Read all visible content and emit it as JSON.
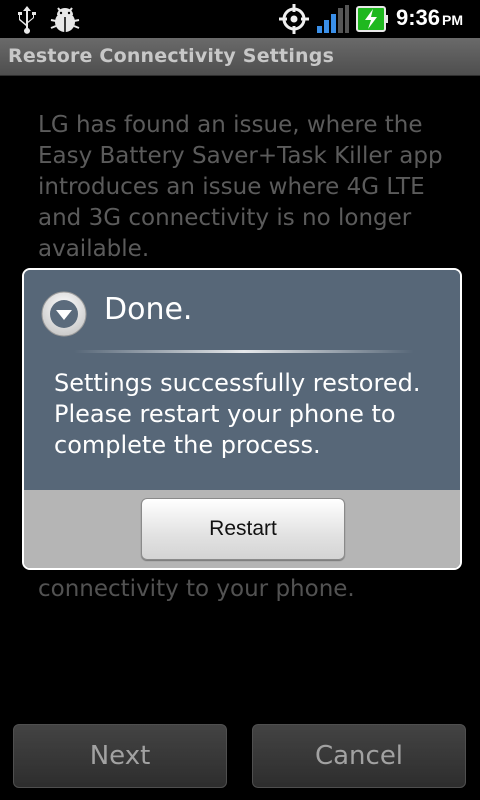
{
  "status_bar": {
    "time": "9:36",
    "ampm": "PM",
    "icons": [
      "usb-icon",
      "debug-icon",
      "gps-icon",
      "signal-icon",
      "battery-charging-icon"
    ]
  },
  "titlebar": {
    "title": "Restore Connectivity Settings"
  },
  "content": {
    "paragraph": "LG has found an issue, where the Easy Battery Saver+Task Killer app introduces an issue where 4G LTE and 3G connectivity is no longer available.",
    "trailing_text": "connectivity to your phone."
  },
  "buttons": {
    "next": "Next",
    "cancel": "Cancel"
  },
  "dialog": {
    "title": "Done.",
    "message": "Settings successfully restored. Please restart your phone to complete the process.",
    "button": "Restart",
    "icon": "dropdown-circle-icon"
  },
  "colors": {
    "dialog_body": "#576778",
    "dialog_footer": "#b5b5b5",
    "battery_green": "#1fb81f"
  }
}
